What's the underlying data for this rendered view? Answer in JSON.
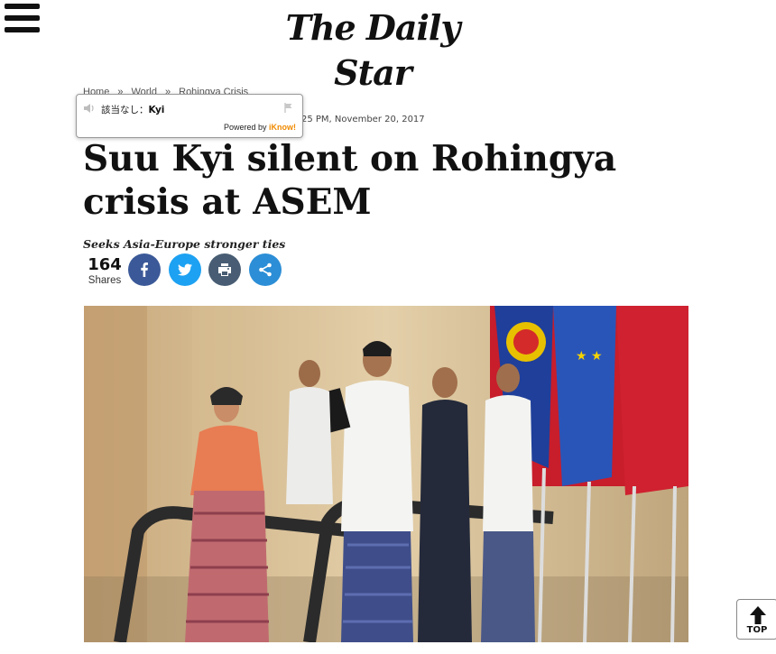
{
  "header": {
    "menu_icon": "hamburger-menu-icon",
    "logo_text": "The Daily Star"
  },
  "breadcrumb": {
    "items": [
      "Home",
      "World",
      "Rohingya Crisis"
    ],
    "separator": "»"
  },
  "article": {
    "dateline_visible": "25 PM, November 20, 2017",
    "headline": "Suu Kyi silent on Rohingya crisis at ASEM",
    "subhead": "Seeks Asia-Europe stronger ties",
    "share_count": "164",
    "share_label": "Shares",
    "share_buttons": [
      {
        "name": "facebook",
        "icon": "facebook-icon",
        "color": "#3b5998"
      },
      {
        "name": "twitter",
        "icon": "twitter-icon",
        "color": "#1da1f2"
      },
      {
        "name": "print",
        "icon": "print-icon",
        "color": "#485d73"
      },
      {
        "name": "share",
        "icon": "share-icon",
        "color": "#2c8ed6"
      }
    ]
  },
  "popup": {
    "speaker_icon": "speaker-icon",
    "no_match_label": "該当なし：",
    "word": "Kyi",
    "flag_icon": "flag-icon",
    "powered_by": "Powered by",
    "brand": "iKnow!"
  },
  "top_button": {
    "label": "TOP",
    "icon": "arrow-up-icon"
  }
}
